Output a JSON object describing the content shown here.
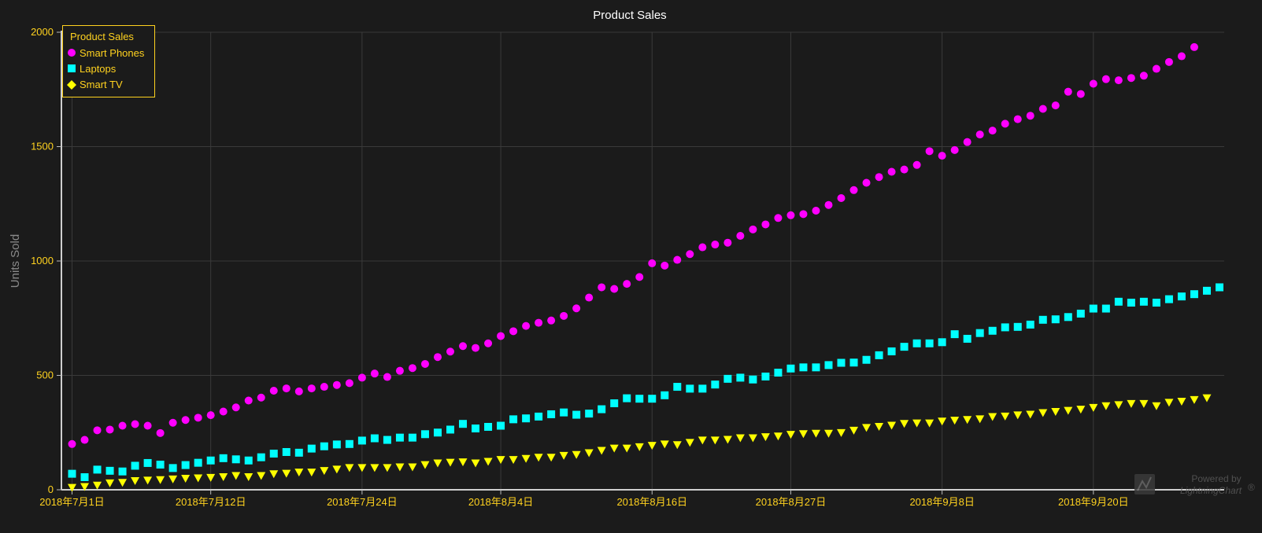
{
  "chart_data": {
    "type": "scatter",
    "title": "Product Sales",
    "ylabel": "Units Sold",
    "xlabel": "",
    "ylim": [
      0,
      2000
    ],
    "y_ticks": [
      0,
      500,
      1000,
      1500,
      2000
    ],
    "x_axis": {
      "type": "date",
      "first_date": "2018-07-01",
      "last_date": "2018-09-30",
      "ticks": [
        {
          "date": "2018-07-01",
          "label": "2018年7月1日"
        },
        {
          "date": "2018-07-12",
          "label": "2018年7月12日"
        },
        {
          "date": "2018-07-24",
          "label": "2018年7月24日"
        },
        {
          "date": "2018-08-04",
          "label": "2018年8月4日"
        },
        {
          "date": "2018-08-16",
          "label": "2018年8月16日"
        },
        {
          "date": "2018-08-27",
          "label": "2018年8月27日"
        },
        {
          "date": "2018-09-08",
          "label": "2018年9月8日"
        },
        {
          "date": "2018-09-20",
          "label": "2018年9月20日"
        }
      ]
    },
    "grid": true,
    "legend": {
      "title": "Product Sales",
      "position": "top-left",
      "border_color": "#ffd21f"
    },
    "series": [
      {
        "name": "Smart Phones",
        "marker": "circle",
        "color": "#ff00ff",
        "values": [
          200,
          218,
          260,
          263,
          280,
          287,
          280,
          248,
          293,
          305,
          315,
          326,
          342,
          360,
          390,
          403,
          433,
          443,
          430,
          443,
          450,
          458,
          466,
          490,
          508,
          493,
          520,
          532,
          550,
          580,
          604,
          628,
          620,
          640,
          672,
          693,
          716,
          730,
          740,
          760,
          793,
          840,
          885,
          878,
          900,
          930,
          990,
          980,
          1005,
          1030,
          1060,
          1072,
          1080,
          1110,
          1138,
          1160,
          1188,
          1200,
          1205,
          1220,
          1245,
          1275,
          1310,
          1342,
          1367,
          1390,
          1400,
          1420,
          1480,
          1460,
          1485,
          1520,
          1553,
          1570,
          1600,
          1620,
          1635,
          1665,
          1680,
          1740,
          1730,
          1775,
          1795,
          1790,
          1800,
          1810,
          1840,
          1870,
          1895,
          1935
        ]
      },
      {
        "name": "Laptops",
        "marker": "square",
        "color": "#00ffff",
        "values": [
          70,
          55,
          88,
          83,
          80,
          105,
          117,
          110,
          95,
          108,
          118,
          128,
          138,
          133,
          128,
          142,
          158,
          165,
          162,
          180,
          190,
          198,
          200,
          215,
          225,
          218,
          228,
          228,
          243,
          250,
          263,
          288,
          268,
          275,
          280,
          308,
          312,
          320,
          330,
          338,
          328,
          333,
          352,
          378,
          400,
          398,
          398,
          413,
          450,
          442,
          442,
          460,
          485,
          490,
          482,
          495,
          512,
          530,
          535,
          535,
          545,
          555,
          556,
          568,
          588,
          605,
          625,
          640,
          640,
          645,
          680,
          660,
          685,
          695,
          710,
          712,
          722,
          743,
          745,
          755,
          770,
          792,
          792,
          822,
          818,
          822,
          818,
          833,
          845,
          855,
          870,
          885
        ]
      },
      {
        "name": "Smart TV",
        "marker": "triangle",
        "color": "#ffff00",
        "values": [
          8,
          12,
          18,
          28,
          30,
          38,
          40,
          42,
          45,
          48,
          50,
          52,
          55,
          60,
          55,
          60,
          68,
          70,
          75,
          75,
          82,
          88,
          95,
          95,
          95,
          95,
          98,
          98,
          108,
          115,
          118,
          120,
          115,
          122,
          130,
          130,
          135,
          140,
          140,
          148,
          152,
          160,
          170,
          180,
          180,
          186,
          192,
          198,
          195,
          205,
          215,
          215,
          218,
          225,
          225,
          230,
          233,
          240,
          243,
          245,
          245,
          248,
          258,
          270,
          275,
          280,
          288,
          290,
          290,
          298,
          302,
          305,
          308,
          318,
          320,
          325,
          328,
          335,
          340,
          345,
          350,
          358,
          365,
          370,
          375,
          375,
          365,
          380,
          385,
          392,
          400
        ]
      }
    ]
  },
  "watermark": {
    "line1": "Powered by",
    "line2": "LightningChart",
    "mark": "®"
  }
}
